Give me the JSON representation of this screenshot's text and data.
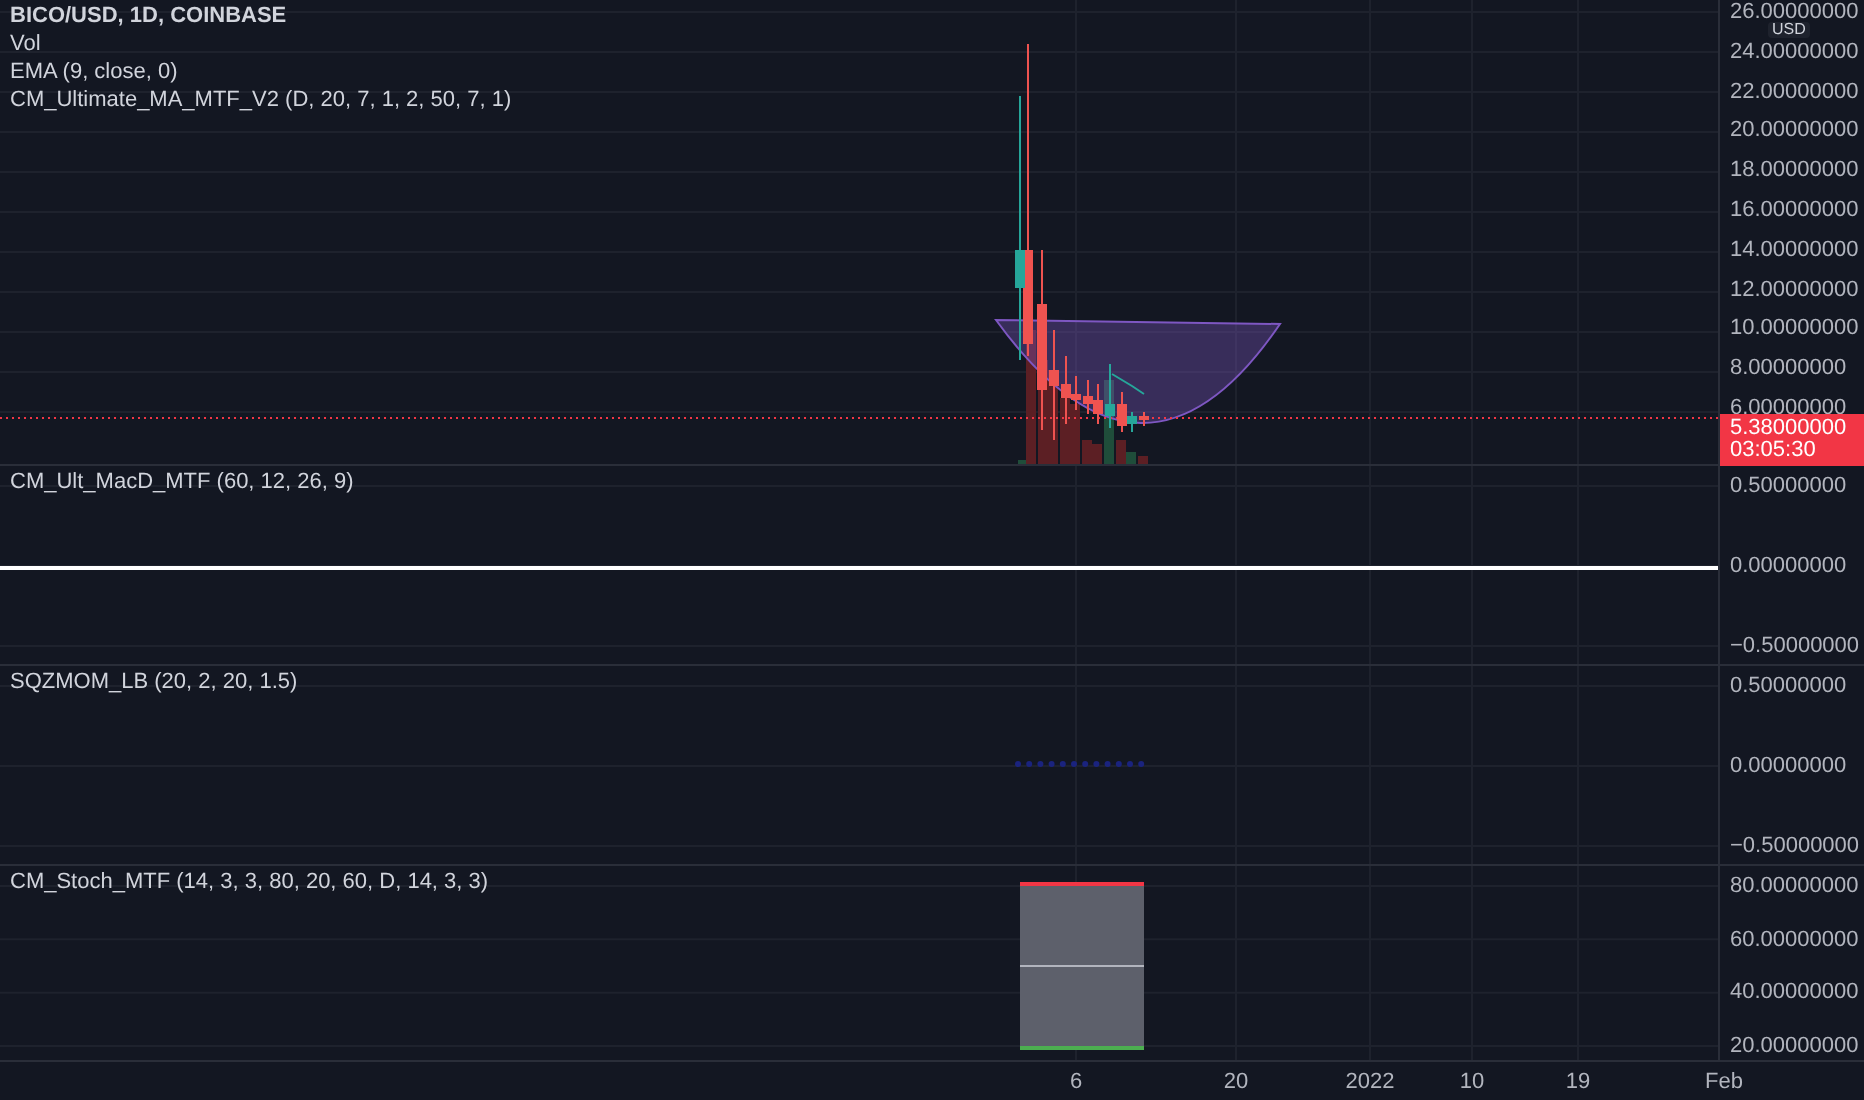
{
  "main": {
    "title": "BICO/USD, 1D, COINBASE",
    "legend": [
      "Vol",
      "EMA (9, close, 0)",
      "CM_Ultimate_MA_MTF_V2 (D, 20, 7, 1, 2, 50, 7, 1)"
    ],
    "currency": "USD",
    "ticks": [
      "26.00000000",
      "24.00000000",
      "22.00000000",
      "20.00000000",
      "18.00000000",
      "16.00000000",
      "14.00000000",
      "12.00000000",
      "10.00000000",
      "8.00000000",
      "6.00000000"
    ],
    "last_price": "5.38000000",
    "countdown": "03:05:30"
  },
  "panes": [
    {
      "kind": "macd",
      "title": "CM_Ult_MacD_MTF (60, 12, 26, 9)",
      "ticks": [
        "0.50000000",
        "0.00000000",
        "−0.50000000"
      ]
    },
    {
      "kind": "squeeze",
      "title": "SQZMOM_LB (20, 2, 20, 1.5)",
      "ticks": [
        "0.50000000",
        "0.00000000",
        "−0.50000000"
      ]
    },
    {
      "kind": "stoch",
      "title": "CM_Stoch_MTF (14, 3, 3, 80, 20, 60, D, 14, 3, 3)",
      "ticks": [
        "80.00000000",
        "60.00000000",
        "40.00000000",
        "20.00000000"
      ]
    }
  ],
  "time_axis": [
    "6",
    "20",
    "2022",
    "10",
    "19",
    "Feb"
  ]
}
